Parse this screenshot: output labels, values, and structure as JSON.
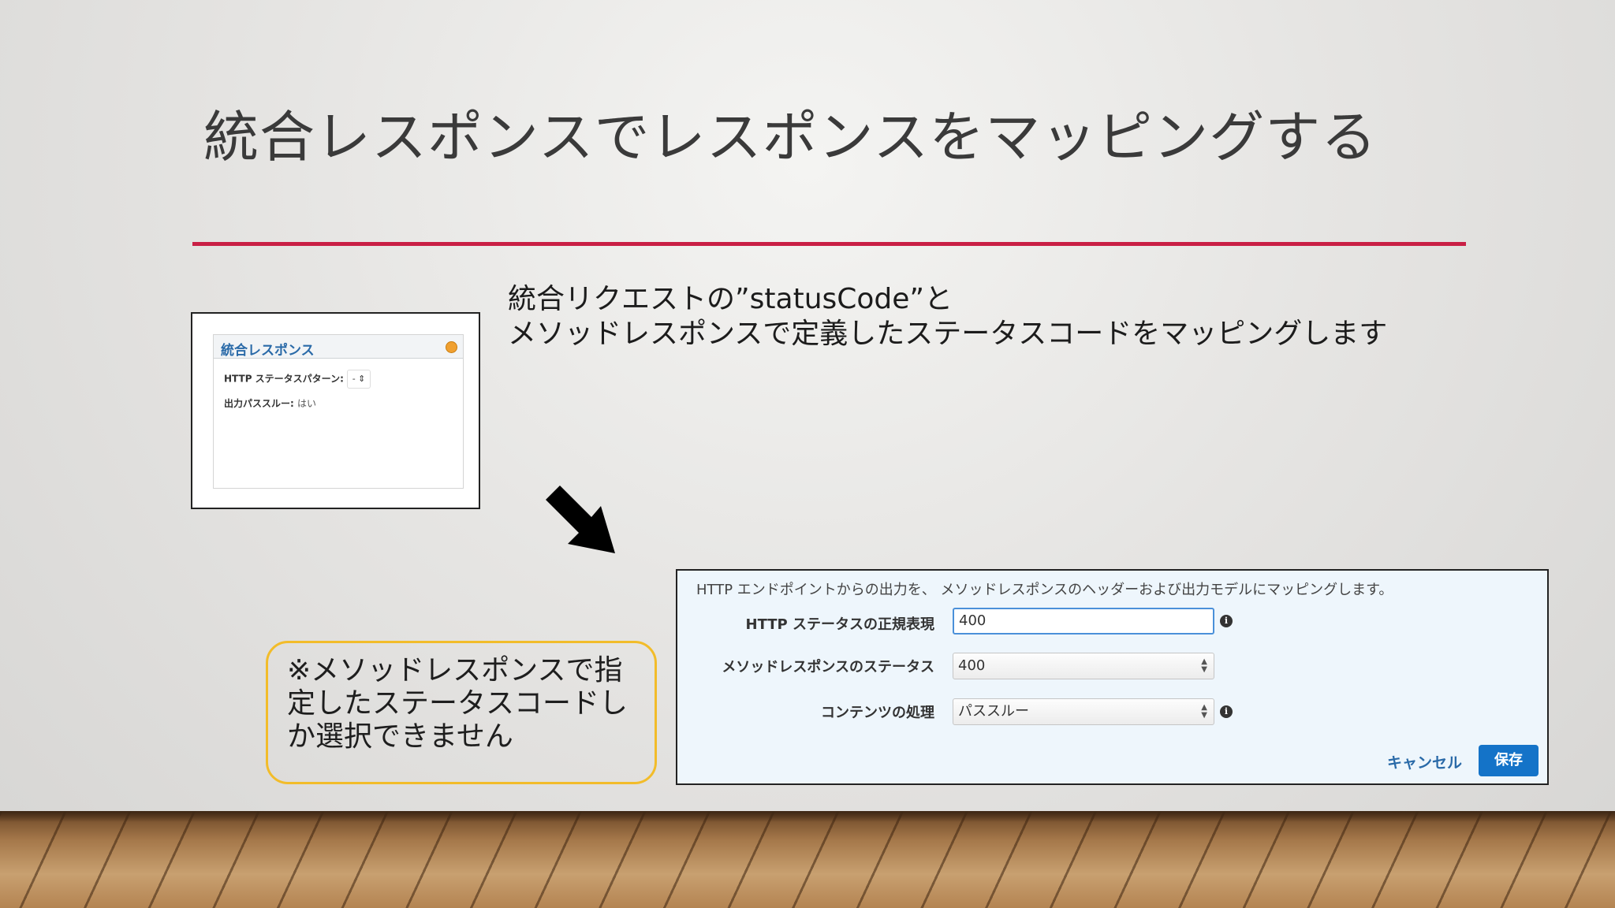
{
  "slide": {
    "title": "統合レスポンスでレスポンスをマッピングする",
    "description_line1": "統合リクエストの”statusCode”と",
    "description_line2": "メソッドレスポンスで定義したステータスコードをマッピングします",
    "note": "※メソッドレスポンスで指定したステータスコードしか選択できません",
    "accent_color": "#c91f45",
    "note_border_color": "#f2bc2a"
  },
  "small_screenshot": {
    "panel_title": "統合レスポンス",
    "status_pattern_label": "HTTP ステータスパターン:",
    "status_pattern_value": "-",
    "passthrough_label": "出力パススルー:",
    "passthrough_value": "はい"
  },
  "big_screenshot": {
    "intro": "HTTP エンドポイントからの出力を、 メソッドレスポンスのヘッダーおよび出力モデルにマッピングします。",
    "regex_label": "HTTP ステータスの正規表現",
    "regex_value": "400",
    "method_status_label": "メソッドレスポンスのステータス",
    "method_status_value": "400",
    "content_label": "コンテンツの処理",
    "content_value": "パススルー",
    "cancel_label": "キャンセル",
    "save_label": "保存",
    "save_color": "#1473c8"
  }
}
